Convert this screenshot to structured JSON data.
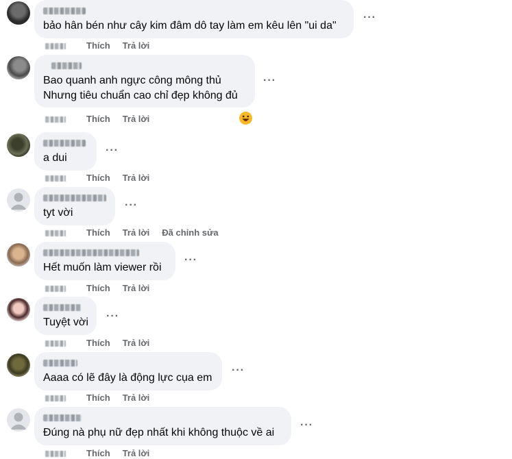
{
  "actions": {
    "like": "Thích",
    "reply": "Trả lời",
    "edited": "Đã chỉnh sửa"
  },
  "icons": {
    "more": "more-options-icon",
    "reaction": "haha-emoji-icon",
    "avatar_default": "default-profile-icon"
  },
  "colors": {
    "bubble_bg": "#f0f2f5",
    "meta_text": "#65676b",
    "emoji": "#f7b928"
  },
  "comments": [
    {
      "text": "bảo hân bén như cây kim đâm dô tay làm em kêu lên \"ui da\""
    },
    {
      "line1": "Bao quanh anh ngực công mông thủ",
      "line2": "Nhưng tiêu chuẩn cao chỉ đẹp không đủ"
    },
    {
      "text": "a dui"
    },
    {
      "text": "tyt vời"
    },
    {
      "text": "Hết muốn làm viewer rồi"
    },
    {
      "text": "Tuyệt vời"
    },
    {
      "text": "Aaaa có lẽ đây là động lực cụa em"
    },
    {
      "text": "Đúng nà phụ nữ đẹp nhất khi không thuộc về ai"
    }
  ]
}
